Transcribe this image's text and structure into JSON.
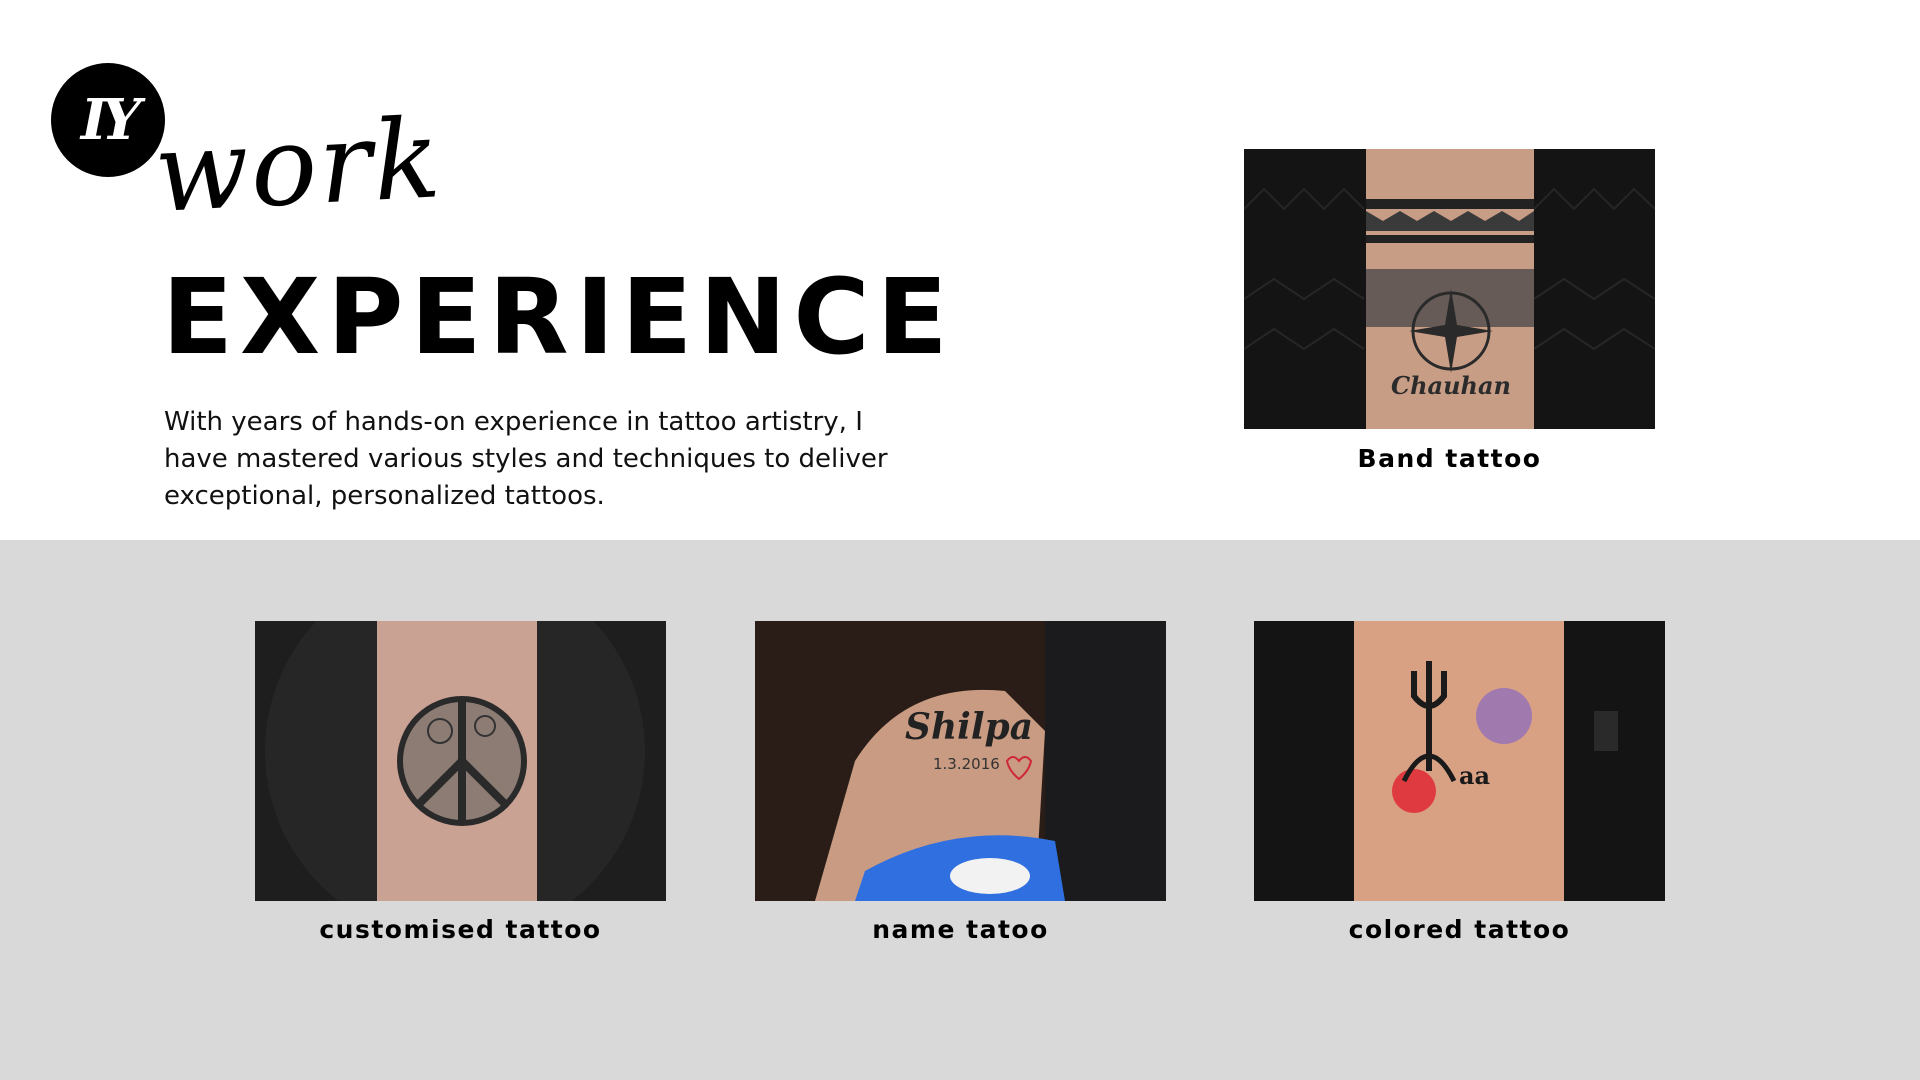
{
  "header": {
    "script_word": "work",
    "main_word": "EXPERIENCE"
  },
  "description": "With years of hands-on experience in tattoo artistry, I have mastered various styles and techniques to deliver exceptional, personalized tattoos.",
  "gallery": [
    {
      "caption": "Band tattoo",
      "tattoo_text": "Chauhan"
    },
    {
      "caption": "customised tattoo"
    },
    {
      "caption": "name tatoo",
      "tattoo_text": "Shilpa",
      "tattoo_date": "1.3.2016"
    },
    {
      "caption": "colored tattoo",
      "tattoo_text": "aa"
    }
  ],
  "colors": {
    "background_top": "#ffffff",
    "background_bottom": "#d9d9d9",
    "text": "#000000",
    "logo_bg": "#000000"
  }
}
